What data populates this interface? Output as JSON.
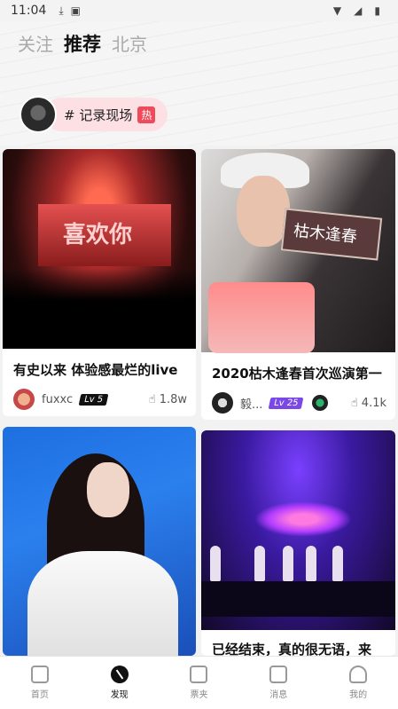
{
  "status": {
    "time": "11:04"
  },
  "tabs": [
    {
      "label": "关注"
    },
    {
      "label": "推荐"
    },
    {
      "label": "北京"
    }
  ],
  "topic": {
    "label": "# 记录现场",
    "badge": "热"
  },
  "cards": [
    {
      "image_text": "喜欢你",
      "title": "有史以来 体验感最烂的live",
      "user": "fuxxc",
      "level": "Lv 5",
      "likes": "1.8w"
    },
    {
      "image_text": "枯木逢春",
      "title": "2020枯木逢春首次巡演第一",
      "user": "毅...",
      "level": "Lv 25",
      "likes": "4.1k"
    },
    {
      "title": ""
    },
    {
      "title": "已经结束，真的很无语，来"
    }
  ],
  "nav": [
    {
      "label": "首页",
      "icon": "home-icon"
    },
    {
      "label": "发现",
      "icon": "compass-icon"
    },
    {
      "label": "票夹",
      "icon": "ticket-icon"
    },
    {
      "label": "消息",
      "icon": "message-icon"
    },
    {
      "label": "我的",
      "icon": "profile-icon"
    }
  ]
}
